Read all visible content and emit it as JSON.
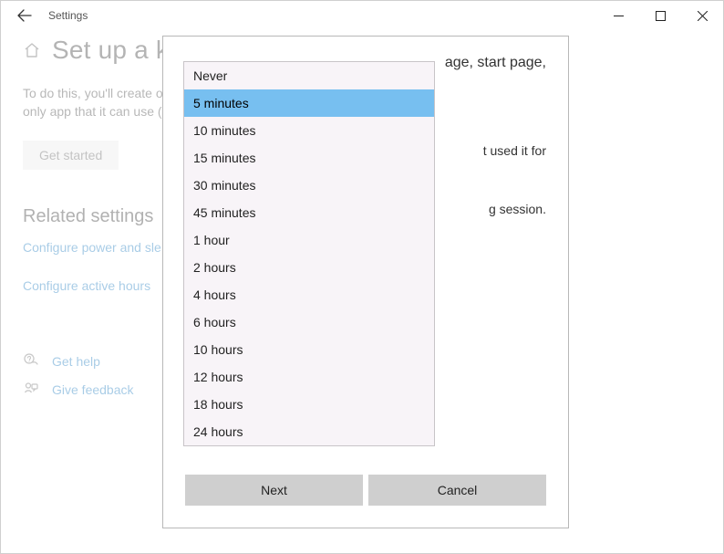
{
  "titlebar": {
    "title": "Settings"
  },
  "page": {
    "heading": "Set up a kiosk",
    "heading_visible": "Set up a k",
    "description_line1": "To do this, you'll create or choose an account, pick a home page, start page,",
    "description_line2": "only app that it can use (…",
    "get_started": "Get started"
  },
  "related": {
    "title": "Related settings",
    "links": [
      "Configure power and sleep",
      "Configure active hours"
    ],
    "links_visible": [
      "Configure power and sle",
      "Configure active hours"
    ]
  },
  "help": {
    "get_help": "Get help",
    "give_feedback": "Give feedback"
  },
  "dialog": {
    "intro": "age, start page,",
    "line2": "t used it for",
    "line3": "g session.",
    "next": "Next",
    "cancel": "Cancel"
  },
  "dropdown": {
    "selected_index": 1,
    "options": [
      "Never",
      "5 minutes",
      "10 minutes",
      "15 minutes",
      "30 minutes",
      "45 minutes",
      "1 hour",
      "2 hours",
      "4 hours",
      "6 hours",
      "10 hours",
      "12 hours",
      "18 hours",
      "24 hours"
    ]
  }
}
